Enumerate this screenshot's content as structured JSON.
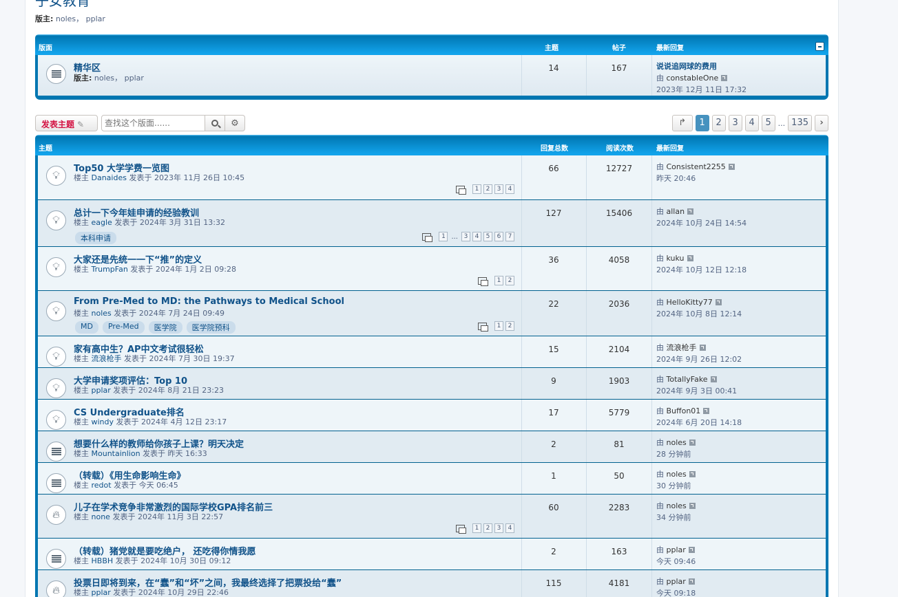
{
  "forum": {
    "title": "子女教育",
    "moderators_label": "版主:",
    "moderators": "noles， pplar"
  },
  "subforum_block": {
    "headers": {
      "forum": "版面",
      "topics": "主题",
      "posts": "帖子",
      "last_post": "最新回复"
    },
    "row": {
      "title": "精华区",
      "moderators_label": "版主:",
      "moderators": "noles， pplar",
      "topics": "14",
      "posts": "167",
      "last_title": "说说追网球的费用",
      "last_by": "由",
      "last_user": "constableOne",
      "last_time": "2023年 12月 11日 17:32"
    }
  },
  "actions": {
    "post_label": "发表主题",
    "search_placeholder": "查找这个版面......",
    "pages": [
      "1",
      "2",
      "3",
      "4",
      "5",
      "...",
      "135"
    ],
    "current_page": "1"
  },
  "topics_block": {
    "headers": {
      "topic": "主题",
      "replies": "回复总数",
      "views": "阅读次数",
      "last_post": "最新回复"
    }
  },
  "topics": [
    {
      "icon": "pin",
      "title": "Top50 大学学费一览图",
      "author_prefix": "楼主",
      "author": "Danaides",
      "posted": "发表于 2023年 11月 26日 10:45",
      "replies": "66",
      "views": "12727",
      "last_user": "Consistent2255",
      "last_time": "昨天 20:46",
      "pages": [
        "1",
        "2",
        "3",
        "4"
      ],
      "tags": []
    },
    {
      "icon": "pin",
      "title": "总计一下今年娃申请的经验教训",
      "author_prefix": "楼主",
      "author": "eagle",
      "posted": "发表于 2024年 3月 31日 13:32",
      "replies": "127",
      "views": "15406",
      "last_user": "allan",
      "last_time": "2024年 10月 24日 14:54",
      "pages": [
        "1",
        "...",
        "3",
        "4",
        "5",
        "6",
        "7"
      ],
      "tags": [
        "本科申请"
      ]
    },
    {
      "icon": "pin",
      "title": "大家还是先统一一下“推”的定义",
      "author_prefix": "楼主",
      "author": "TrumpFan",
      "posted": "发表于 2024年 1月 2日 09:28",
      "replies": "36",
      "views": "4058",
      "last_user": "kuku",
      "last_time": "2024年 10月 12日 12:18",
      "pages": [
        "1",
        "2"
      ],
      "tags": []
    },
    {
      "icon": "pin",
      "title": "From Pre-Med to MD: the Pathways to Medical School",
      "author_prefix": "楼主",
      "author": "noles",
      "posted": "发表于 2024年 7月 24日 09:49",
      "replies": "22",
      "views": "2036",
      "last_user": "HelloKitty77",
      "last_time": "2024年 10月 8日 12:14",
      "pages": [
        "1",
        "2"
      ],
      "tags": [
        "MD",
        "Pre-Med",
        "医学院",
        "医学院预科"
      ]
    },
    {
      "icon": "pin",
      "title": "家有高中生？AP中文考试很轻松",
      "author_prefix": "楼主",
      "author": "流浪枪手",
      "posted": "发表于 2024年 7月 30日 19:37",
      "replies": "15",
      "views": "2104",
      "last_user": "流浪枪手",
      "last_time": "2024年 9月 26日 12:02",
      "pages": [],
      "tags": []
    },
    {
      "icon": "pin",
      "title": "大学申请奖项评估：Top 10",
      "author_prefix": "楼主",
      "author": "pplar",
      "posted": "发表于 2024年 8月 21日 23:23",
      "replies": "9",
      "views": "1903",
      "last_user": "TotallyFake",
      "last_time": "2024年 9月 3日 00:41",
      "pages": [],
      "tags": []
    },
    {
      "icon": "pin",
      "title": "CS Undergraduate排名",
      "author_prefix": "楼主",
      "author": "windy",
      "posted": "发表于 2024年 4月 12日 23:17",
      "replies": "17",
      "views": "5779",
      "last_user": "Buffon01",
      "last_time": "2024年 6月 20日 14:18",
      "pages": [],
      "tags": []
    },
    {
      "icon": "normal",
      "title": "想要什么样的教师给你孩子上课？明天决定",
      "author_prefix": "楼主",
      "author": "Mountainlion",
      "posted": "发表于 昨天 16:33",
      "replies": "2",
      "views": "81",
      "last_user": "noles",
      "last_time": "28 分钟前",
      "pages": [],
      "tags": []
    },
    {
      "icon": "normal",
      "title": "（转载）《用生命影响生命》",
      "author_prefix": "楼主",
      "author": "redot",
      "posted": "发表于 今天 06:45",
      "replies": "1",
      "views": "50",
      "last_user": "noles",
      "last_time": "30 分钟前",
      "pages": [],
      "tags": []
    },
    {
      "icon": "hot",
      "title": "儿子在学术竞争非常激烈的国际学校GPA排名前三",
      "author_prefix": "楼主",
      "author": "none",
      "posted": "发表于 2024年 11月 3日 22:57",
      "replies": "60",
      "views": "2283",
      "last_user": "noles",
      "last_time": "34 分钟前",
      "pages": [
        "1",
        "2",
        "3",
        "4"
      ],
      "tags": []
    },
    {
      "icon": "normal",
      "title": "（转载）猪党就是要吃绝户， 还吃得你情我愿",
      "author_prefix": "楼主",
      "author": "HBBH",
      "posted": "发表于 2024年 10月 30日 09:12",
      "replies": "2",
      "views": "163",
      "last_user": "pplar",
      "last_time": "今天 09:46",
      "pages": [],
      "tags": []
    },
    {
      "icon": "hot",
      "title": "投票日即将到来，在“蠢”和“坏”之间，我最终选择了把票投给“蠢”",
      "author_prefix": "楼主",
      "author": "pplar",
      "posted": "发表于 2024年 10月 29日 22:46",
      "replies": "115",
      "views": "4181",
      "last_user": "pplar",
      "last_time": "今天 09:18",
      "pages": [],
      "tags": []
    }
  ],
  "last_by": "由"
}
